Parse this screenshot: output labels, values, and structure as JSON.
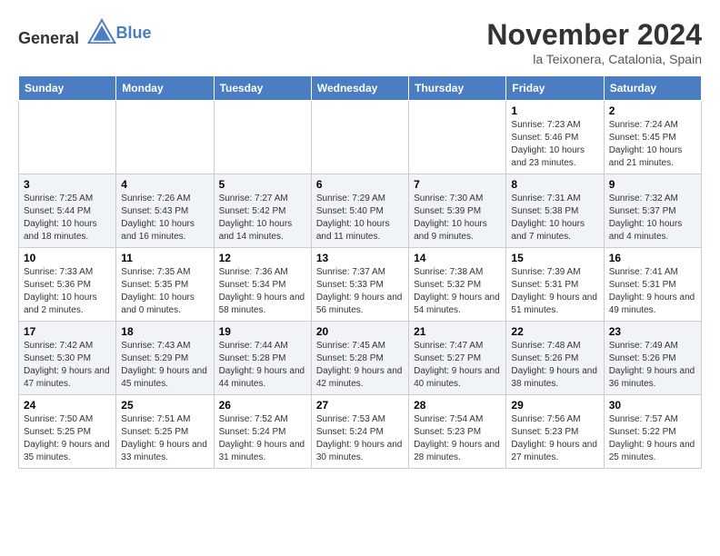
{
  "header": {
    "logo_general": "General",
    "logo_blue": "Blue",
    "month": "November 2024",
    "location": "la Teixonera, Catalonia, Spain"
  },
  "weekdays": [
    "Sunday",
    "Monday",
    "Tuesday",
    "Wednesday",
    "Thursday",
    "Friday",
    "Saturday"
  ],
  "weeks": [
    [
      {
        "day": "",
        "info": ""
      },
      {
        "day": "",
        "info": ""
      },
      {
        "day": "",
        "info": ""
      },
      {
        "day": "",
        "info": ""
      },
      {
        "day": "",
        "info": ""
      },
      {
        "day": "1",
        "info": "Sunrise: 7:23 AM\nSunset: 5:46 PM\nDaylight: 10 hours and 23 minutes."
      },
      {
        "day": "2",
        "info": "Sunrise: 7:24 AM\nSunset: 5:45 PM\nDaylight: 10 hours and 21 minutes."
      }
    ],
    [
      {
        "day": "3",
        "info": "Sunrise: 7:25 AM\nSunset: 5:44 PM\nDaylight: 10 hours and 18 minutes."
      },
      {
        "day": "4",
        "info": "Sunrise: 7:26 AM\nSunset: 5:43 PM\nDaylight: 10 hours and 16 minutes."
      },
      {
        "day": "5",
        "info": "Sunrise: 7:27 AM\nSunset: 5:42 PM\nDaylight: 10 hours and 14 minutes."
      },
      {
        "day": "6",
        "info": "Sunrise: 7:29 AM\nSunset: 5:40 PM\nDaylight: 10 hours and 11 minutes."
      },
      {
        "day": "7",
        "info": "Sunrise: 7:30 AM\nSunset: 5:39 PM\nDaylight: 10 hours and 9 minutes."
      },
      {
        "day": "8",
        "info": "Sunrise: 7:31 AM\nSunset: 5:38 PM\nDaylight: 10 hours and 7 minutes."
      },
      {
        "day": "9",
        "info": "Sunrise: 7:32 AM\nSunset: 5:37 PM\nDaylight: 10 hours and 4 minutes."
      }
    ],
    [
      {
        "day": "10",
        "info": "Sunrise: 7:33 AM\nSunset: 5:36 PM\nDaylight: 10 hours and 2 minutes."
      },
      {
        "day": "11",
        "info": "Sunrise: 7:35 AM\nSunset: 5:35 PM\nDaylight: 10 hours and 0 minutes."
      },
      {
        "day": "12",
        "info": "Sunrise: 7:36 AM\nSunset: 5:34 PM\nDaylight: 9 hours and 58 minutes."
      },
      {
        "day": "13",
        "info": "Sunrise: 7:37 AM\nSunset: 5:33 PM\nDaylight: 9 hours and 56 minutes."
      },
      {
        "day": "14",
        "info": "Sunrise: 7:38 AM\nSunset: 5:32 PM\nDaylight: 9 hours and 54 minutes."
      },
      {
        "day": "15",
        "info": "Sunrise: 7:39 AM\nSunset: 5:31 PM\nDaylight: 9 hours and 51 minutes."
      },
      {
        "day": "16",
        "info": "Sunrise: 7:41 AM\nSunset: 5:31 PM\nDaylight: 9 hours and 49 minutes."
      }
    ],
    [
      {
        "day": "17",
        "info": "Sunrise: 7:42 AM\nSunset: 5:30 PM\nDaylight: 9 hours and 47 minutes."
      },
      {
        "day": "18",
        "info": "Sunrise: 7:43 AM\nSunset: 5:29 PM\nDaylight: 9 hours and 45 minutes."
      },
      {
        "day": "19",
        "info": "Sunrise: 7:44 AM\nSunset: 5:28 PM\nDaylight: 9 hours and 44 minutes."
      },
      {
        "day": "20",
        "info": "Sunrise: 7:45 AM\nSunset: 5:28 PM\nDaylight: 9 hours and 42 minutes."
      },
      {
        "day": "21",
        "info": "Sunrise: 7:47 AM\nSunset: 5:27 PM\nDaylight: 9 hours and 40 minutes."
      },
      {
        "day": "22",
        "info": "Sunrise: 7:48 AM\nSunset: 5:26 PM\nDaylight: 9 hours and 38 minutes."
      },
      {
        "day": "23",
        "info": "Sunrise: 7:49 AM\nSunset: 5:26 PM\nDaylight: 9 hours and 36 minutes."
      }
    ],
    [
      {
        "day": "24",
        "info": "Sunrise: 7:50 AM\nSunset: 5:25 PM\nDaylight: 9 hours and 35 minutes."
      },
      {
        "day": "25",
        "info": "Sunrise: 7:51 AM\nSunset: 5:25 PM\nDaylight: 9 hours and 33 minutes."
      },
      {
        "day": "26",
        "info": "Sunrise: 7:52 AM\nSunset: 5:24 PM\nDaylight: 9 hours and 31 minutes."
      },
      {
        "day": "27",
        "info": "Sunrise: 7:53 AM\nSunset: 5:24 PM\nDaylight: 9 hours and 30 minutes."
      },
      {
        "day": "28",
        "info": "Sunrise: 7:54 AM\nSunset: 5:23 PM\nDaylight: 9 hours and 28 minutes."
      },
      {
        "day": "29",
        "info": "Sunrise: 7:56 AM\nSunset: 5:23 PM\nDaylight: 9 hours and 27 minutes."
      },
      {
        "day": "30",
        "info": "Sunrise: 7:57 AM\nSunset: 5:22 PM\nDaylight: 9 hours and 25 minutes."
      }
    ]
  ]
}
